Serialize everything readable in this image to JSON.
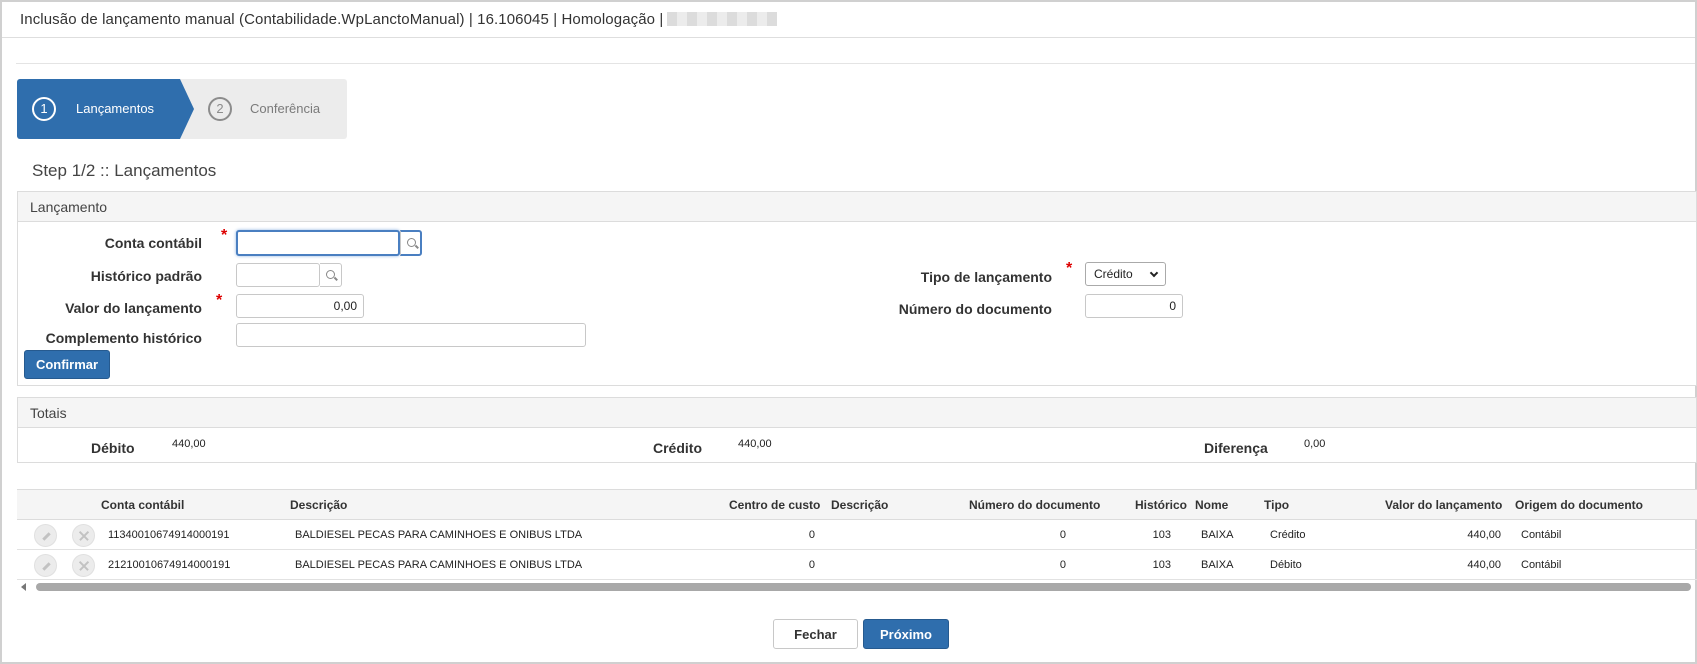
{
  "window": {
    "title": "Inclusão de lançamento manual (Contabilidade.WpLanctoManual) | 16.106045 | Homologação |"
  },
  "wizard": {
    "steps": [
      {
        "number": "1",
        "label": "Lançamentos",
        "active": true
      },
      {
        "number": "2",
        "label": "Conferência",
        "active": false
      }
    ],
    "heading": "Step 1/2 :: Lançamentos"
  },
  "lancamento": {
    "header": "Lançamento",
    "conta_contabil": {
      "label": "Conta contábil",
      "value": ""
    },
    "historico_padrao": {
      "label": "Histórico padrão",
      "value": ""
    },
    "valor_lancamento": {
      "label": "Valor do lançamento",
      "value": "0,00"
    },
    "complemento_historico": {
      "label": "Complemento histórico",
      "value": ""
    },
    "tipo_lancamento": {
      "label": "Tipo de lançamento",
      "value": "Crédito"
    },
    "numero_documento": {
      "label": "Número do documento",
      "value": "0"
    },
    "required_mark": "*",
    "confirm_label": "Confirmar"
  },
  "totais": {
    "header": "Totais",
    "debito": {
      "label": "Débito",
      "value": "440,00"
    },
    "credito": {
      "label": "Crédito",
      "value": "440,00"
    },
    "diferenca": {
      "label": "Diferença",
      "value": "0,00"
    }
  },
  "grid": {
    "columns": [
      "Conta contábil",
      "Descrição",
      "Centro de custo",
      "Descrição",
      "Número do documento",
      "Histórico",
      "Nome",
      "Tipo",
      "Valor do lançamento",
      "Origem do documento"
    ],
    "rows": [
      {
        "conta": "11340010674914000191",
        "descricao": "BALDIESEL PECAS PARA CAMINHOES E ONIBUS LTDA",
        "centro_custo": "0",
        "descricao_cc": "",
        "numero_documento": "0",
        "historico": "103",
        "nome": "BAIXA",
        "tipo": "Crédito",
        "valor": "440,00",
        "origem": "Contábil"
      },
      {
        "conta": "21210010674914000191",
        "descricao": "BALDIESEL PECAS PARA CAMINHOES E ONIBUS LTDA",
        "centro_custo": "0",
        "descricao_cc": "",
        "numero_documento": "0",
        "historico": "103",
        "nome": "BAIXA",
        "tipo": "Débito",
        "valor": "440,00",
        "origem": "Contábil"
      }
    ]
  },
  "footer": {
    "close_label": "Fechar",
    "next_label": "Próximo"
  },
  "colors": {
    "primary": "#2f6ead",
    "required": "#dd0000"
  }
}
